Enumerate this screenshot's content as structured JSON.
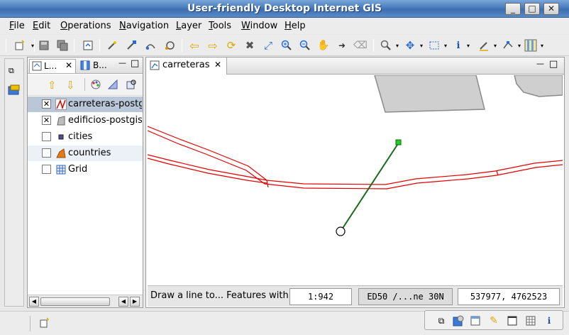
{
  "window": {
    "title": "User-friendly Desktop Internet GIS",
    "controls": {
      "minimize": "_",
      "maximize": "□",
      "close": "✕"
    }
  },
  "menu": [
    {
      "label": "File",
      "mnemonic": "F",
      "rest": "ile"
    },
    {
      "label": "Edit",
      "mnemonic": "E",
      "rest": "dit"
    },
    {
      "label": "Operations",
      "mnemonic": "O",
      "rest": "perations"
    },
    {
      "label": "Navigation",
      "mnemonic": "N",
      "rest": "avigation"
    },
    {
      "label": "Layer",
      "mnemonic": "L",
      "rest": "ayer"
    },
    {
      "label": "Tools",
      "mnemonic": "T",
      "rest": "ools"
    },
    {
      "label": "Window",
      "mnemonic": "W",
      "rest": "indow"
    },
    {
      "label": "Help",
      "mnemonic": "H",
      "rest": "elp"
    }
  ],
  "toolbar": {
    "icons": [
      "new-icon",
      "save-icon",
      "save-all-icon",
      "export-icon",
      "edit-pen-icon",
      "add-vertex-icon",
      "draw-line-icon",
      "draw-polygon-icon",
      "back-icon",
      "forward-icon",
      "refresh-icon",
      "stop-icon",
      "zoom-extent-icon",
      "zoom-in-icon",
      "zoom-out-icon",
      "pan-icon",
      "next-icon",
      "eraser-icon",
      "search-icon",
      "move-icon",
      "select-icon",
      "info-icon",
      "edit-tool-icon",
      "vertex-tool-icon",
      "layout-icon"
    ]
  },
  "layers_panel": {
    "tabs": [
      {
        "label": "L...",
        "close": "✕"
      },
      {
        "label": "B..."
      }
    ],
    "minimize": "—",
    "maximize": "□",
    "layers": [
      {
        "name": "carreteras-postgis",
        "checked": true,
        "selected": true,
        "icon": "line-layer-icon"
      },
      {
        "name": "edificios-postgis",
        "checked": true,
        "selected": false,
        "icon": "polygon-layer-icon"
      },
      {
        "name": "cities",
        "checked": false,
        "selected": false,
        "icon": "point-layer-icon"
      },
      {
        "name": "countries",
        "checked": false,
        "selected": false,
        "icon": "area-layer-icon"
      },
      {
        "name": "Grid",
        "checked": false,
        "selected": false,
        "icon": "grid-layer-icon"
      }
    ]
  },
  "map_panel": {
    "tab": {
      "label": "carreteras",
      "close": "✕"
    },
    "minimize": "—",
    "maximize": "□",
    "status": {
      "message": "Draw a line to... Features with",
      "scale": "1:942",
      "crs": "ED50 /...ne 30N",
      "coordinates": "537977, 4762523"
    }
  },
  "colors": {
    "road": "#e00000",
    "building_fill": "#cfcfcf",
    "building_stroke": "#8a8a8a",
    "measure_line": "#1b6a1b",
    "measure_point": "#22cc22",
    "selection_bg": "#bac7d9"
  }
}
